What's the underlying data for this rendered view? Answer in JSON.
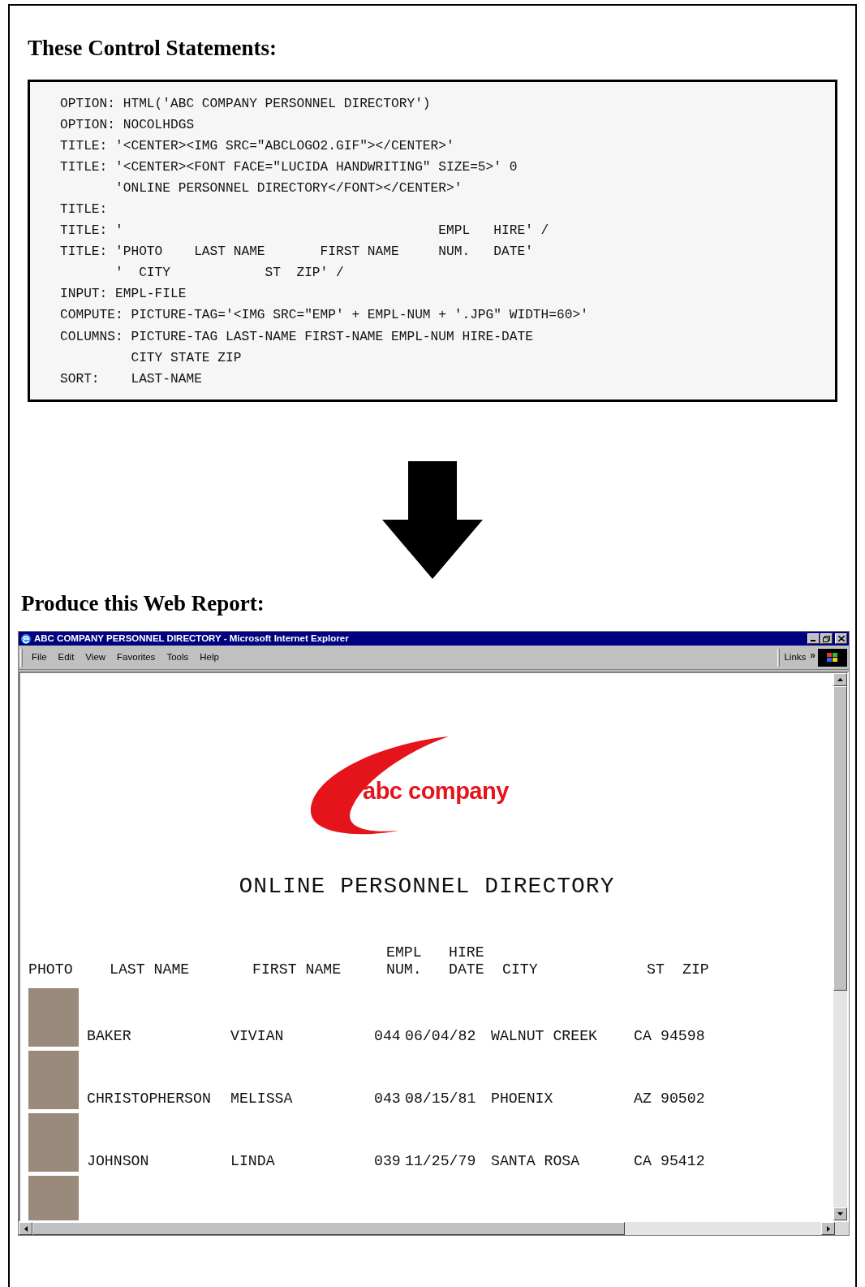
{
  "control_heading": "These Control Statements:",
  "code_lines": [
    "OPTION: HTML('ABC COMPANY PERSONNEL DIRECTORY')",
    "OPTION: NOCOLHDGS",
    "TITLE: '<CENTER><IMG SRC=\"ABCLOGO2.GIF\"></CENTER>'",
    "TITLE: '<CENTER><FONT FACE=\"LUCIDA HANDWRITING\" SIZE=5>' 0",
    "       'ONLINE PERSONNEL DIRECTORY</FONT></CENTER>'",
    "TITLE:",
    "TITLE: '                                        EMPL   HIRE' /",
    "TITLE: 'PHOTO    LAST NAME       FIRST NAME     NUM.   DATE'",
    "       '  CITY            ST  ZIP' /",
    "INPUT: EMPL-FILE",
    "COMPUTE: PICTURE-TAG='<IMG SRC=\"EMP' + EMPL-NUM + '.JPG\" WIDTH=60>'",
    "COLUMNS: PICTURE-TAG LAST-NAME FIRST-NAME EMPL-NUM HIRE-DATE",
    "         CITY STATE ZIP",
    "SORT:    LAST-NAME"
  ],
  "report_heading": "Produce this Web Report:",
  "browser": {
    "title": "ABC COMPANY PERSONNEL DIRECTORY - Microsoft Internet Explorer",
    "menu": [
      "File",
      "Edit",
      "View",
      "Favorites",
      "Tools",
      "Help"
    ],
    "links_label": "Links",
    "links_chevron": "»",
    "logo_text": "abc company",
    "report_title": "ONLINE PERSONNEL DIRECTORY",
    "columns": [
      [
        "PHOTO"
      ],
      [
        "LAST NAME"
      ],
      [
        "FIRST NAME"
      ],
      [
        "EMPL",
        "NUM."
      ],
      [
        "HIRE",
        "DATE"
      ],
      [
        "CITY"
      ],
      [
        "ST"
      ],
      [
        "ZIP"
      ]
    ],
    "rows": [
      {
        "last_name": "BAKER",
        "first_name": "VIVIAN",
        "empl_num": "044",
        "hire_date": "06/04/82",
        "city": "WALNUT CREEK",
        "st": "CA",
        "zip": "94598"
      },
      {
        "last_name": "CHRISTOPHERSON",
        "first_name": "MELISSA",
        "empl_num": "043",
        "hire_date": "08/15/81",
        "city": "PHOENIX",
        "st": "AZ",
        "zip": "90502"
      },
      {
        "last_name": "JOHNSON",
        "first_name": "LINDA",
        "empl_num": "039",
        "hire_date": "11/25/79",
        "city": "SANTA ROSA",
        "st": "CA",
        "zip": "95412"
      }
    ],
    "more_rows_below": true
  }
}
